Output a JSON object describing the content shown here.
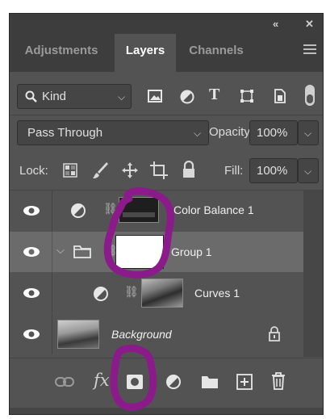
{
  "titlebar": {
    "collapse_glyph": "«",
    "close_glyph": "✕"
  },
  "tabs": [
    {
      "label": "Adjustments",
      "active": false
    },
    {
      "label": "Layers",
      "active": true
    },
    {
      "label": "Channels",
      "active": false
    }
  ],
  "filter": {
    "label": "Kind",
    "icon": "search-icon"
  },
  "blend": {
    "mode": "Pass Through",
    "opacity_label": "Opacity:",
    "opacity_value": "100%"
  },
  "lock": {
    "label": "Lock:",
    "fill_label": "Fill:",
    "fill_value": "100%"
  },
  "layers": [
    {
      "name": "Color Balance 1",
      "type": "adjustment",
      "selected": false
    },
    {
      "name": "Group 1",
      "type": "group",
      "selected": true,
      "expanded": true
    },
    {
      "name": "Curves 1",
      "type": "adjustment",
      "selected": false,
      "indented": true
    },
    {
      "name": "Background",
      "type": "background",
      "selected": false,
      "locked": true
    }
  ],
  "footer": {
    "fx_label": "fx"
  },
  "colors": {
    "panel": "#535353",
    "tabbar": "#3d3d3d",
    "selected_row": "#6b6b6b",
    "annotation": "#8b1a8b"
  }
}
